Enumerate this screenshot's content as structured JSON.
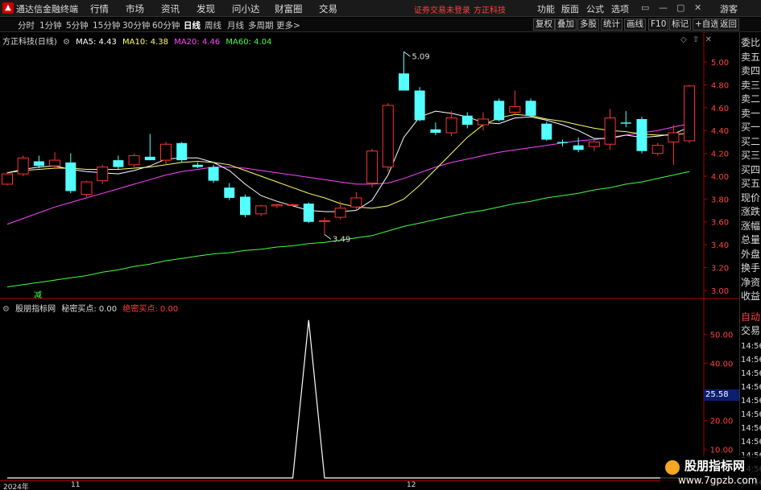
{
  "app": {
    "title": "通达信金融终端",
    "logo_glyph": "▲",
    "menus": [
      "行情",
      "市场",
      "资讯",
      "发现",
      "问小达",
      "财富圈",
      "交易"
    ],
    "notice": "证券交易未登录",
    "broker": "方正科技",
    "right_links": [
      "功能",
      "版面",
      "公式",
      "选项"
    ],
    "window_buttons": [
      "▭",
      "—",
      "▢",
      "✕"
    ],
    "guest": "游客"
  },
  "toolbar": {
    "periods": [
      "分时",
      "1分钟",
      "5分钟",
      "15分钟",
      "30分钟",
      "60分钟",
      "日线",
      "周线",
      "月线",
      "多周期",
      "更多>"
    ],
    "active_period": "日线",
    "right_buttons": [
      "复权",
      "叠加",
      "多股",
      "统计",
      "画线",
      "F10",
      "标记",
      "+自选",
      "返回"
    ]
  },
  "main_chart": {
    "stock_title": "方正科技(日线)",
    "ma_legend": [
      {
        "label": "MA5: 4.43",
        "color": "#ffffff"
      },
      {
        "label": "MA10: 4.38",
        "color": "#ffff66"
      },
      {
        "label": "MA20: 4.46",
        "color": "#ff44ff"
      },
      {
        "label": "MA60: 4.04",
        "color": "#44ff44"
      }
    ],
    "high_label": "5.09",
    "low_label": "3.49",
    "marker_glyph": "减"
  },
  "sub_chart": {
    "title": "股朋指标网",
    "label1": "秘密买点: 0.00",
    "label2": "绝密买点: 0.00",
    "value_badge": "25.58"
  },
  "side_panel": {
    "items": [
      "委比",
      "卖五",
      "卖四",
      "卖三",
      "卖二",
      "卖一",
      "买一",
      "买二",
      "买三",
      "买四",
      "买五",
      "现价",
      "涨跌",
      "涨幅",
      "总量",
      "外盘",
      "换手",
      "净资",
      "收益"
    ],
    "auto_trade": [
      "自动",
      "交易"
    ],
    "times": [
      "14:56",
      "14:56",
      "14:56",
      "14:56",
      "14:56",
      "14:56",
      "14:56",
      "14:56",
      "14:56",
      "14:56",
      "14:56"
    ]
  },
  "bottom_axis": {
    "labels": [
      "2024年",
      "11",
      "12"
    ]
  },
  "watermark": {
    "line1": "股朋指标网",
    "line2": "www.7gpzb.com"
  },
  "colors": {
    "up": "#ff3333",
    "down": "#54ffff",
    "ma5": "#ffffff",
    "ma10": "#ffff66",
    "ma20": "#ff44ff",
    "ma60": "#44ff44",
    "axis_red": "#aa0000"
  },
  "chart_data": [
    {
      "type": "candlestick",
      "ylim": [
        2.95,
        5.12
      ],
      "y_ticks": [
        "5.00",
        "4.80",
        "4.60",
        "4.40",
        "4.20",
        "4.00",
        "3.80",
        "3.60",
        "3.40",
        "3.20",
        "3.00"
      ],
      "y_tick_values": [
        5.0,
        4.8,
        4.6,
        4.4,
        4.2,
        4.0,
        3.8,
        3.6,
        3.4,
        3.2,
        3.0
      ],
      "candles": [
        {
          "o": 3.93,
          "h": 4.04,
          "l": 3.92,
          "c": 4.02
        },
        {
          "o": 4.02,
          "h": 4.18,
          "l": 4.0,
          "c": 4.16
        },
        {
          "o": 4.13,
          "h": 4.18,
          "l": 4.07,
          "c": 4.09
        },
        {
          "o": 4.09,
          "h": 4.21,
          "l": 4.06,
          "c": 4.14
        },
        {
          "o": 4.12,
          "h": 4.2,
          "l": 3.85,
          "c": 3.87
        },
        {
          "o": 3.84,
          "h": 3.96,
          "l": 3.82,
          "c": 3.95
        },
        {
          "o": 3.96,
          "h": 4.1,
          "l": 3.93,
          "c": 4.08
        },
        {
          "o": 4.14,
          "h": 4.18,
          "l": 4.06,
          "c": 4.08
        },
        {
          "o": 4.1,
          "h": 4.2,
          "l": 4.08,
          "c": 4.18
        },
        {
          "o": 4.17,
          "h": 4.37,
          "l": 4.14,
          "c": 4.14
        },
        {
          "o": 4.14,
          "h": 4.3,
          "l": 4.1,
          "c": 4.28
        },
        {
          "o": 4.29,
          "h": 4.3,
          "l": 4.12,
          "c": 4.14
        },
        {
          "o": 4.1,
          "h": 4.12,
          "l": 4.07,
          "c": 4.08
        },
        {
          "o": 4.08,
          "h": 4.1,
          "l": 3.94,
          "c": 3.96
        },
        {
          "o": 3.9,
          "h": 3.94,
          "l": 3.79,
          "c": 3.81
        },
        {
          "o": 3.82,
          "h": 3.84,
          "l": 3.64,
          "c": 3.66
        },
        {
          "o": 3.67,
          "h": 3.75,
          "l": 3.65,
          "c": 3.74
        },
        {
          "o": 3.74,
          "h": 3.76,
          "l": 3.72,
          "c": 3.75
        },
        {
          "o": 3.75,
          "h": 3.76,
          "l": 3.74,
          "c": 3.75
        },
        {
          "o": 3.76,
          "h": 3.77,
          "l": 3.59,
          "c": 3.6
        },
        {
          "o": 3.61,
          "h": 3.64,
          "l": 3.49,
          "c": 3.61
        },
        {
          "o": 3.64,
          "h": 3.78,
          "l": 3.62,
          "c": 3.72
        },
        {
          "o": 3.73,
          "h": 3.86,
          "l": 3.7,
          "c": 3.81
        },
        {
          "o": 3.94,
          "h": 4.24,
          "l": 3.9,
          "c": 4.22
        },
        {
          "o": 4.08,
          "h": 4.64,
          "l": 4.04,
          "c": 4.62
        },
        {
          "o": 4.9,
          "h": 5.09,
          "l": 4.75,
          "c": 4.75
        },
        {
          "o": 4.75,
          "h": 4.78,
          "l": 4.48,
          "c": 4.49
        },
        {
          "o": 4.41,
          "h": 4.47,
          "l": 4.36,
          "c": 4.38
        },
        {
          "o": 4.38,
          "h": 4.57,
          "l": 4.35,
          "c": 4.51
        },
        {
          "o": 4.53,
          "h": 4.56,
          "l": 4.42,
          "c": 4.45
        },
        {
          "o": 4.45,
          "h": 4.56,
          "l": 4.4,
          "c": 4.5
        },
        {
          "o": 4.66,
          "h": 4.68,
          "l": 4.48,
          "c": 4.49
        },
        {
          "o": 4.56,
          "h": 4.75,
          "l": 4.54,
          "c": 4.61
        },
        {
          "o": 4.66,
          "h": 4.68,
          "l": 4.52,
          "c": 4.53
        },
        {
          "o": 4.46,
          "h": 4.48,
          "l": 4.31,
          "c": 4.32
        },
        {
          "o": 4.3,
          "h": 4.32,
          "l": 4.26,
          "c": 4.29
        },
        {
          "o": 4.27,
          "h": 4.34,
          "l": 4.21,
          "c": 4.23
        },
        {
          "o": 4.26,
          "h": 4.32,
          "l": 4.22,
          "c": 4.3
        },
        {
          "o": 4.28,
          "h": 4.59,
          "l": 4.23,
          "c": 4.51
        },
        {
          "o": 4.47,
          "h": 4.57,
          "l": 4.43,
          "c": 4.46
        },
        {
          "o": 4.5,
          "h": 4.52,
          "l": 4.2,
          "c": 4.22
        },
        {
          "o": 4.2,
          "h": 4.29,
          "l": 4.18,
          "c": 4.27
        },
        {
          "o": 4.3,
          "h": 4.45,
          "l": 4.1,
          "c": 4.38
        },
        {
          "o": 4.31,
          "h": 4.8,
          "l": 4.29,
          "c": 4.79
        }
      ],
      "ma5": [
        4.03,
        4.06,
        4.08,
        4.09,
        4.06,
        4.04,
        4.03,
        4.02,
        4.05,
        4.09,
        4.15,
        4.16,
        4.16,
        4.12,
        4.05,
        3.93,
        3.83,
        3.78,
        3.74,
        3.7,
        3.69,
        3.69,
        3.7,
        3.79,
        4.01,
        4.34,
        4.52,
        4.57,
        4.55,
        4.52,
        4.47,
        4.46,
        4.51,
        4.52,
        4.49,
        4.45,
        4.4,
        4.33,
        4.33,
        4.36,
        4.34,
        4.35,
        4.37,
        4.43
      ],
      "ma10": [
        4.03,
        4.05,
        4.06,
        4.07,
        4.07,
        4.06,
        4.06,
        4.06,
        4.07,
        4.08,
        4.1,
        4.12,
        4.13,
        4.12,
        4.1,
        4.05,
        4.0,
        3.95,
        3.9,
        3.85,
        3.81,
        3.76,
        3.73,
        3.72,
        3.74,
        3.8,
        3.92,
        4.06,
        4.2,
        4.34,
        4.45,
        4.51,
        4.54,
        4.53,
        4.5,
        4.48,
        4.45,
        4.42,
        4.4,
        4.39,
        4.37,
        4.36,
        4.36,
        4.38
      ],
      "ma20": [
        3.58,
        3.63,
        3.68,
        3.73,
        3.77,
        3.81,
        3.85,
        3.89,
        3.93,
        3.97,
        4.01,
        4.04,
        4.06,
        4.08,
        4.08,
        4.07,
        4.05,
        4.03,
        4.01,
        3.99,
        3.97,
        3.95,
        3.93,
        3.93,
        3.94,
        3.98,
        4.03,
        4.08,
        4.12,
        4.15,
        4.18,
        4.21,
        4.23,
        4.25,
        4.27,
        4.29,
        4.31,
        4.32,
        4.34,
        4.36,
        4.38,
        4.4,
        4.43,
        4.46
      ],
      "ma60": [
        3.03,
        3.05,
        3.07,
        3.09,
        3.11,
        3.13,
        3.16,
        3.18,
        3.21,
        3.23,
        3.26,
        3.28,
        3.3,
        3.32,
        3.33,
        3.35,
        3.36,
        3.38,
        3.39,
        3.41,
        3.42,
        3.44,
        3.46,
        3.48,
        3.52,
        3.56,
        3.59,
        3.62,
        3.65,
        3.68,
        3.7,
        3.73,
        3.76,
        3.78,
        3.81,
        3.83,
        3.85,
        3.88,
        3.9,
        3.93,
        3.95,
        3.98,
        4.01,
        4.04
      ]
    },
    {
      "type": "line",
      "ylim": [
        0,
        60
      ],
      "y_ticks": [
        "50.00",
        "40.00",
        "30.00",
        "20.00",
        "10.00"
      ],
      "y_tick_values": [
        50,
        40,
        30,
        20,
        10
      ],
      "series": [
        {
          "values": [
            0,
            0,
            0,
            0,
            0,
            0,
            0,
            0,
            0,
            0,
            0,
            0,
            0,
            0,
            0,
            0,
            0,
            0,
            0,
            55,
            0,
            0,
            0,
            0,
            0,
            0,
            0,
            0,
            0,
            0,
            0,
            0,
            0,
            0,
            0,
            0,
            0,
            0,
            0,
            0,
            0,
            0,
            0,
            0
          ]
        }
      ]
    }
  ]
}
